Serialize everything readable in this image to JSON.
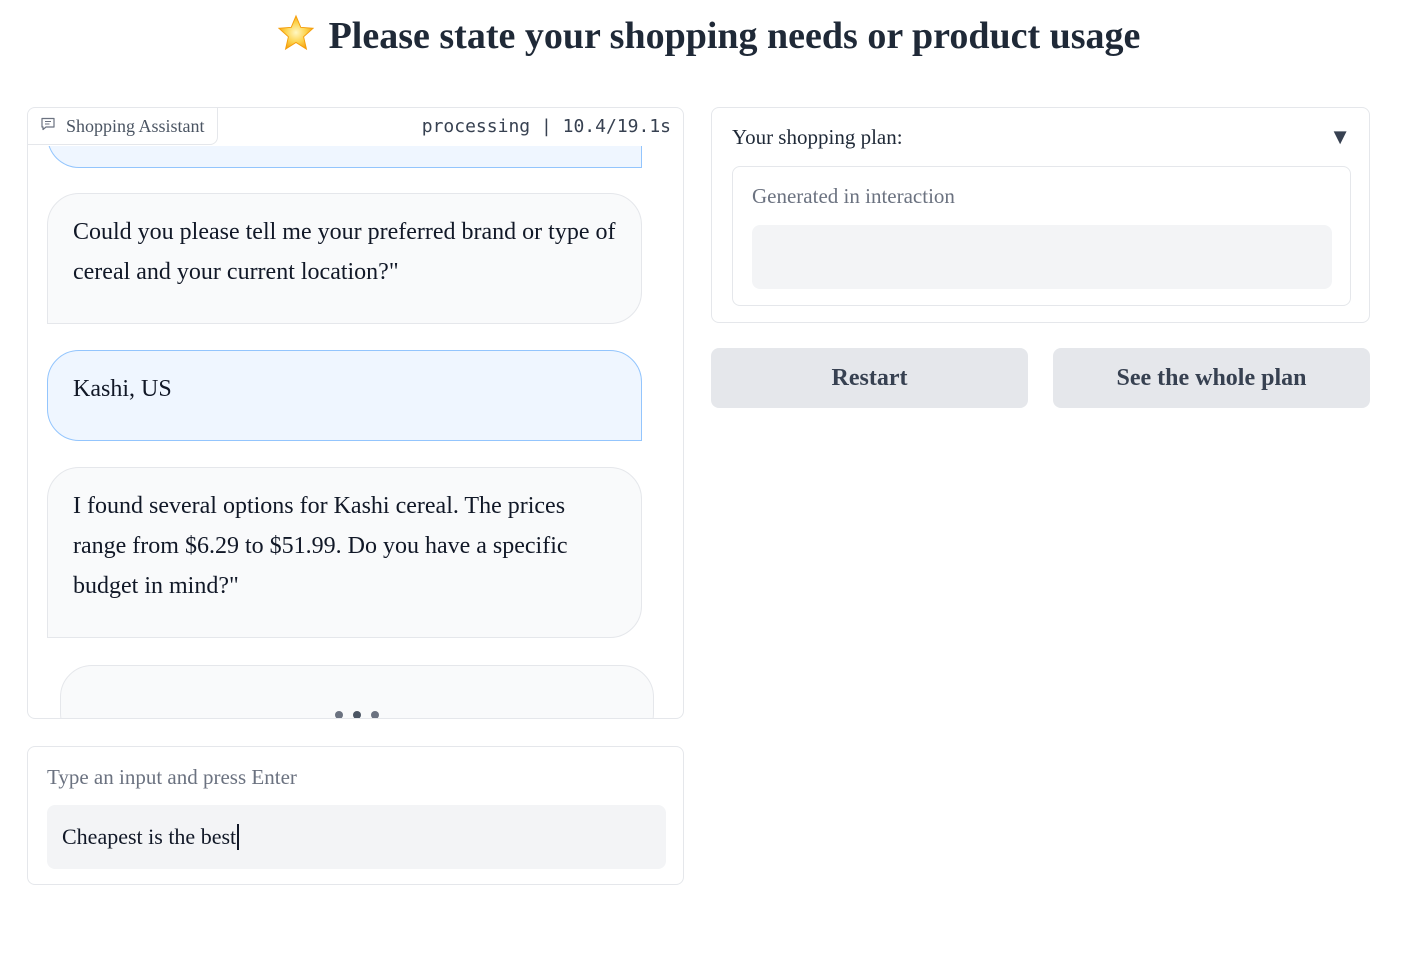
{
  "header": {
    "icon": "star-emoji",
    "title": "Please state your shopping needs or product usage"
  },
  "chat": {
    "label": "Shopping Assistant",
    "status": "processing | 10.4/19.1s",
    "messages": [
      {
        "role": "user",
        "text": ""
      },
      {
        "role": "assistant",
        "text": "Could you please tell me your preferred brand or type of cereal and your current location?\""
      },
      {
        "role": "user",
        "text": "Kashi, US"
      },
      {
        "role": "assistant",
        "text": "I found several options for Kashi cereal. The prices range from $6.29 to $51.99. Do you have a specific budget in mind?\""
      }
    ]
  },
  "input": {
    "label": "Type an input and press Enter",
    "value": "Cheapest is the best"
  },
  "plan": {
    "title": "Your shopping plan:",
    "toggle": "▼",
    "inner_label": "Generated in interaction",
    "value": ""
  },
  "buttons": {
    "restart": "Restart",
    "whole_plan": "See the whole plan"
  },
  "colors": {
    "user_bubble_bg": "#eff6ff",
    "user_bubble_border": "#93c5fd",
    "bot_bubble_bg": "#f9fafb",
    "button_bg": "#e5e7eb"
  }
}
